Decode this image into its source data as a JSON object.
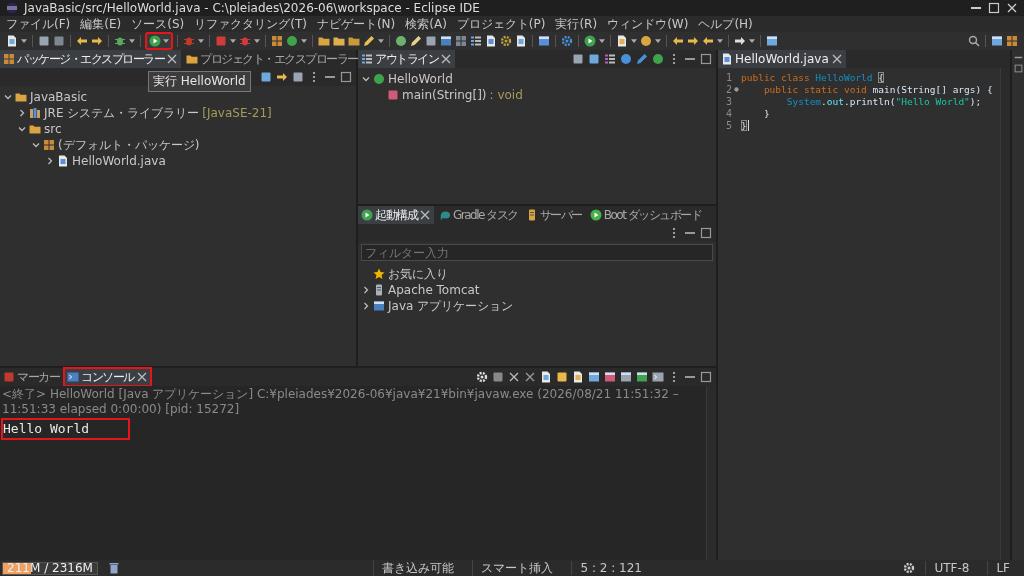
{
  "window": {
    "title": "JavaBasic/src/HelloWorld.java - C:\\pleiades\\2026-06\\workspace - Eclipse IDE"
  },
  "menu": [
    "ファイル(F)",
    "編集(E)",
    "ソース(S)",
    "リファクタリング(T)",
    "ナビゲート(N)",
    "検索(A)",
    "プロジェクト(P)",
    "実行(R)",
    "ウィンドウ(W)",
    "ヘルプ(H)"
  ],
  "toolbar": {
    "run_button": {
      "highlighted": true
    },
    "tooltip": "実行 HelloWorld"
  },
  "package_explorer": {
    "tabs": [
      {
        "label": "パッケージ・エクスプローラー",
        "selected": true,
        "highlighted": false
      },
      {
        "label": "プロジェクト・エクスプローラー",
        "selected": false,
        "highlighted": false
      }
    ],
    "tree": [
      {
        "label": "JavaBasic",
        "kind": "project",
        "expanded": true,
        "children": [
          {
            "label": "JRE システム・ライブラリー",
            "decoration": "[JavaSE-21]",
            "kind": "library",
            "expanded": false
          },
          {
            "label": "src",
            "kind": "source_folder",
            "expanded": true,
            "children": [
              {
                "label": "(デフォルト・パッケージ)",
                "kind": "package",
                "expanded": true,
                "children": [
                  {
                    "label": "HelloWorld.java",
                    "kind": "java_file",
                    "expanded": false
                  }
                ]
              }
            ]
          }
        ]
      }
    ]
  },
  "outline": {
    "tabs": [
      {
        "label": "アウトライン",
        "selected": true,
        "highlighted": false
      }
    ],
    "tree": [
      {
        "label": "HelloWorld",
        "kind": "class",
        "expanded": true,
        "children": [
          {
            "label": "main(String[])",
            "decoration": ": void",
            "kind": "method"
          }
        ]
      }
    ]
  },
  "launch": {
    "tabs": [
      {
        "label": "起動構成",
        "selected": true,
        "highlighted": false
      },
      {
        "label": "Gradle タスク",
        "selected": false,
        "highlighted": false
      },
      {
        "label": "サーバー",
        "selected": false,
        "highlighted": false
      },
      {
        "label": "Boot ダッシュボード",
        "selected": false,
        "highlighted": false
      }
    ],
    "filter": {
      "placeholder": "フィルター入力"
    },
    "tree": [
      {
        "label": "お気に入り",
        "kind": "favorites"
      },
      {
        "label": "Apache Tomcat",
        "kind": "server",
        "expanded": false
      },
      {
        "label": "Java アプリケーション",
        "kind": "application",
        "expanded": false
      }
    ]
  },
  "console": {
    "tabs": [
      {
        "label": "マーカー",
        "selected": false,
        "highlighted": false
      },
      {
        "label": "コンソール",
        "selected": true,
        "highlighted": true
      }
    ],
    "header": "<終了> HelloWorld [Java アプリケーション] C:¥pleiades¥2026-06¥java¥21¥bin¥javaw.exe  (2026/08/21 11:51:32 – 11:51:33 elapsed 0:00:00) [pid: 15272]",
    "output": {
      "text": "Hello World",
      "highlighted": true
    }
  },
  "editor": {
    "tabs": [
      {
        "label": "HelloWorld.java",
        "selected": true,
        "highlighted": false
      }
    ],
    "lines": [
      {
        "number": "1",
        "override_marker": false,
        "current": false,
        "tokens": [
          {
            "text": "public class ",
            "kind": "keyword"
          },
          {
            "text": "HelloWorld ",
            "kind": "class"
          },
          {
            "text": "{",
            "kind": "bracket_match"
          }
        ]
      },
      {
        "number": "2",
        "override_marker": true,
        "current": false,
        "tokens": [
          {
            "text": "    public static void ",
            "kind": "keyword"
          },
          {
            "text": "main(String[] args) {",
            "kind": "plain"
          }
        ]
      },
      {
        "number": "3",
        "override_marker": false,
        "current": false,
        "tokens": [
          {
            "text": "        System",
            "kind": "class"
          },
          {
            "text": ".",
            "kind": "plain"
          },
          {
            "text": "out",
            "kind": "field"
          },
          {
            "text": ".println(",
            "kind": "plain"
          },
          {
            "text": "\"Hello World\"",
            "kind": "string"
          },
          {
            "text": ");",
            "kind": "plain"
          }
        ]
      },
      {
        "number": "4",
        "override_marker": false,
        "current": false,
        "tokens": [
          {
            "text": "    }",
            "kind": "plain"
          }
        ]
      },
      {
        "number": "5",
        "override_marker": false,
        "current": true,
        "tokens": [
          {
            "text": "}",
            "kind": "bracket_match"
          }
        ]
      }
    ]
  },
  "status_bar": {
    "memory": {
      "text": "211M / 2316M",
      "level": 0.3
    },
    "write_mode": "書き込み可能",
    "insert_mode": "スマート挿入",
    "position": "5 : 2 : 121",
    "encoding": "UTF-8",
    "line_delimiter": "LF"
  }
}
